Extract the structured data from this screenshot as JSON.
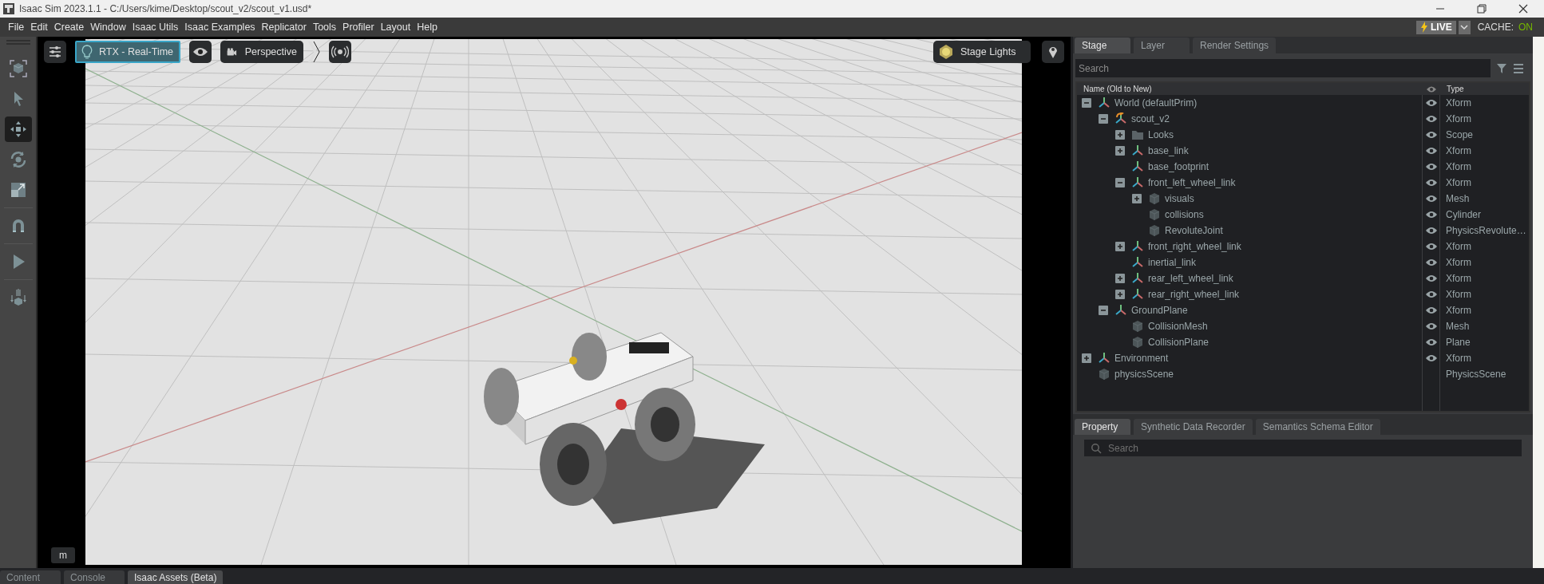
{
  "window": {
    "title": "Isaac Sim 2023.1.1 - C:/Users/kime/Desktop/scout_v2/scout_v1.usd*"
  },
  "menu_bar": [
    "File",
    "Edit",
    "Create",
    "Window",
    "Isaac Utils",
    "Isaac Examples",
    "Replicator",
    "Tools",
    "Profiler",
    "Layout",
    "Help"
  ],
  "status": {
    "live": "LIVE",
    "cache_label": "CACHE:",
    "cache_value": "ON"
  },
  "left_toolbar": [
    {
      "kind": "frame",
      "selected": false
    },
    {
      "kind": "select",
      "selected": false
    },
    {
      "kind": "move",
      "selected": true
    },
    {
      "kind": "rotate",
      "selected": false
    },
    {
      "kind": "scale",
      "selected": false
    },
    {
      "kind": "snap",
      "selected": false
    },
    {
      "kind": "play",
      "selected": false
    },
    {
      "kind": "drop",
      "selected": false
    }
  ],
  "viewport": {
    "renderer": "RTX - Real-Time",
    "camera": "Perspective",
    "lights": "Stage Lights",
    "hotkey_badge": "m"
  },
  "stage_panel": {
    "tabs": [
      {
        "label": "Stage",
        "selected": true
      },
      {
        "label": "Layer",
        "selected": false
      },
      {
        "label": "Render Settings",
        "selected": false
      }
    ],
    "search": {
      "placeholder": "Search"
    },
    "columns": [
      "Name (Old to New)",
      "Type"
    ],
    "tree": [
      {
        "name": "World (defaultPrim)",
        "type": "Xform",
        "kind": "xform",
        "expanded": true,
        "visible": true,
        "children": [
          {
            "name": "scout_v2",
            "type": "Xform",
            "kind": "xform_ref",
            "expanded": true,
            "visible": true,
            "children": [
              {
                "name": "Looks",
                "type": "Scope",
                "kind": "folder",
                "expanded": false,
                "visible": true
              },
              {
                "name": "base_link",
                "type": "Xform",
                "kind": "xform",
                "expanded": false,
                "visible": true
              },
              {
                "name": "base_footprint",
                "type": "Xform",
                "kind": "xform",
                "visible": true
              },
              {
                "name": "front_left_wheel_link",
                "type": "Xform",
                "kind": "xform",
                "expanded": true,
                "visible": true,
                "children": [
                  {
                    "name": "visuals",
                    "type": "Mesh",
                    "kind": "mesh",
                    "expanded": false,
                    "visible": true
                  },
                  {
                    "name": "collisions",
                    "type": "Cylinder",
                    "kind": "mesh",
                    "visible": true
                  },
                  {
                    "name": "RevoluteJoint",
                    "type": "PhysicsRevolute…",
                    "kind": "mesh",
                    "visible": true
                  }
                ]
              },
              {
                "name": "front_right_wheel_link",
                "type": "Xform",
                "kind": "xform",
                "expanded": false,
                "visible": true
              },
              {
                "name": "inertial_link",
                "type": "Xform",
                "kind": "xform",
                "visible": true
              },
              {
                "name": "rear_left_wheel_link",
                "type": "Xform",
                "kind": "xform",
                "expanded": false,
                "visible": true
              },
              {
                "name": "rear_right_wheel_link",
                "type": "Xform",
                "kind": "xform",
                "expanded": false,
                "visible": true
              }
            ]
          },
          {
            "name": "GroundPlane",
            "type": "Xform",
            "kind": "xform",
            "expanded": true,
            "visible": true,
            "children": [
              {
                "name": "CollisionMesh",
                "type": "Mesh",
                "kind": "mesh",
                "visible": true
              },
              {
                "name": "CollisionPlane",
                "type": "Plane",
                "kind": "mesh",
                "visible": true
              }
            ]
          }
        ]
      },
      {
        "name": "Environment",
        "type": "Xform",
        "kind": "xform",
        "expanded": false,
        "visible": true
      },
      {
        "name": "physicsScene",
        "type": "PhysicsScene",
        "kind": "mesh",
        "visible": false
      }
    ]
  },
  "property_panel": {
    "tabs": [
      {
        "label": "Property",
        "selected": true
      },
      {
        "label": "Synthetic Data Recorder",
        "selected": false
      },
      {
        "label": "Semantics Schema Editor",
        "selected": false
      }
    ],
    "search": {
      "placeholder": "Search"
    }
  },
  "bottom_tabs": [
    {
      "label": "Content",
      "selected": false
    },
    {
      "label": "Console",
      "selected": false
    },
    {
      "label": "Isaac Assets (Beta)",
      "selected": true
    }
  ]
}
